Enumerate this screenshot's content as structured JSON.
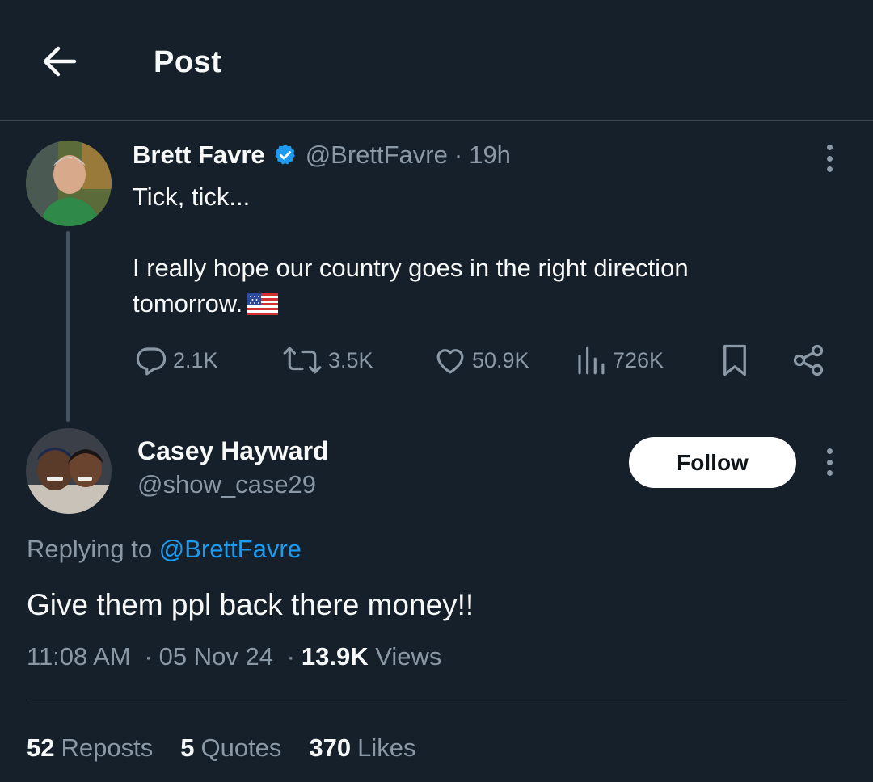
{
  "header": {
    "title": "Post"
  },
  "parent_tweet": {
    "author_name": "Brett Favre",
    "handle": "@BrettFavre",
    "time": "19h",
    "separator": "·",
    "line1": "Tick, tick...",
    "line2": "I really hope our country goes in the right direction",
    "line3": "tomorrow.",
    "emoji_icon": "us-flag-icon",
    "replies": "2.1K",
    "reposts": "3.5K",
    "likes": "50.9K",
    "views": "726K"
  },
  "reply": {
    "author_name": "Casey Hayward",
    "handle": "@show_case29",
    "follow_label": "Follow",
    "replying_prefix": "Replying to",
    "replying_handle": "@BrettFavre",
    "text": "Give them ppl back there money!!",
    "time": "11:08 AM",
    "date": "05 Nov 24",
    "separator": "·",
    "views_count": "13.9K",
    "views_label": "Views"
  },
  "stats": {
    "reposts_count": "52",
    "reposts_label": "Reposts",
    "quotes_count": "5",
    "quotes_label": "Quotes",
    "likes_count": "370",
    "likes_label": "Likes"
  },
  "colors": {
    "background": "#15202b",
    "muted_text": "#8b98a5",
    "link_blue": "#1d9bf0",
    "verified_blue": "#1d9bf0",
    "divider": "#38444d"
  }
}
